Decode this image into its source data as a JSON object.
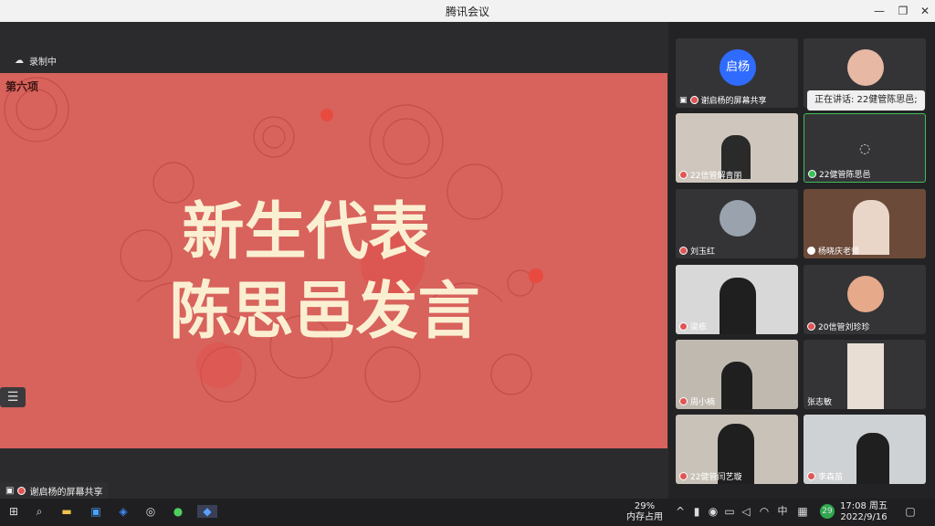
{
  "window": {
    "title": "腾讯会议"
  },
  "recording": {
    "label": "录制中"
  },
  "slide": {
    "section": "第六项",
    "line1": "新生代表",
    "line2": "陈思邑发言"
  },
  "share": {
    "banner": "谢启杨的屏幕共享"
  },
  "speaking": {
    "text": "正在讲话: 22健管陈思邑;"
  },
  "participants": [
    {
      "name": "谢启杨的屏幕共享",
      "avatar": "启杨"
    },
    {
      "name": ""
    },
    {
      "name": "22信管解青丽"
    },
    {
      "name": "22健管陈思邑"
    },
    {
      "name": "刘玉红"
    },
    {
      "name": "杨晓庆老师"
    },
    {
      "name": "梁栋"
    },
    {
      "name": "20信管刘珍珍"
    },
    {
      "name": "周小楠"
    },
    {
      "name": "张志敏"
    },
    {
      "name": "22健管闫艺璇"
    },
    {
      "name": "李森苗"
    }
  ],
  "taskbar": {
    "mem_percent": "29%",
    "mem_label": "内存占用",
    "ime": "中",
    "time": "17:08 周五",
    "date": "2022/9/16",
    "badge": "29"
  },
  "colors": {
    "slide_bg": "#d8625c",
    "slide_text": "#fbefd2",
    "avatar_blue": "#2f6bff"
  }
}
